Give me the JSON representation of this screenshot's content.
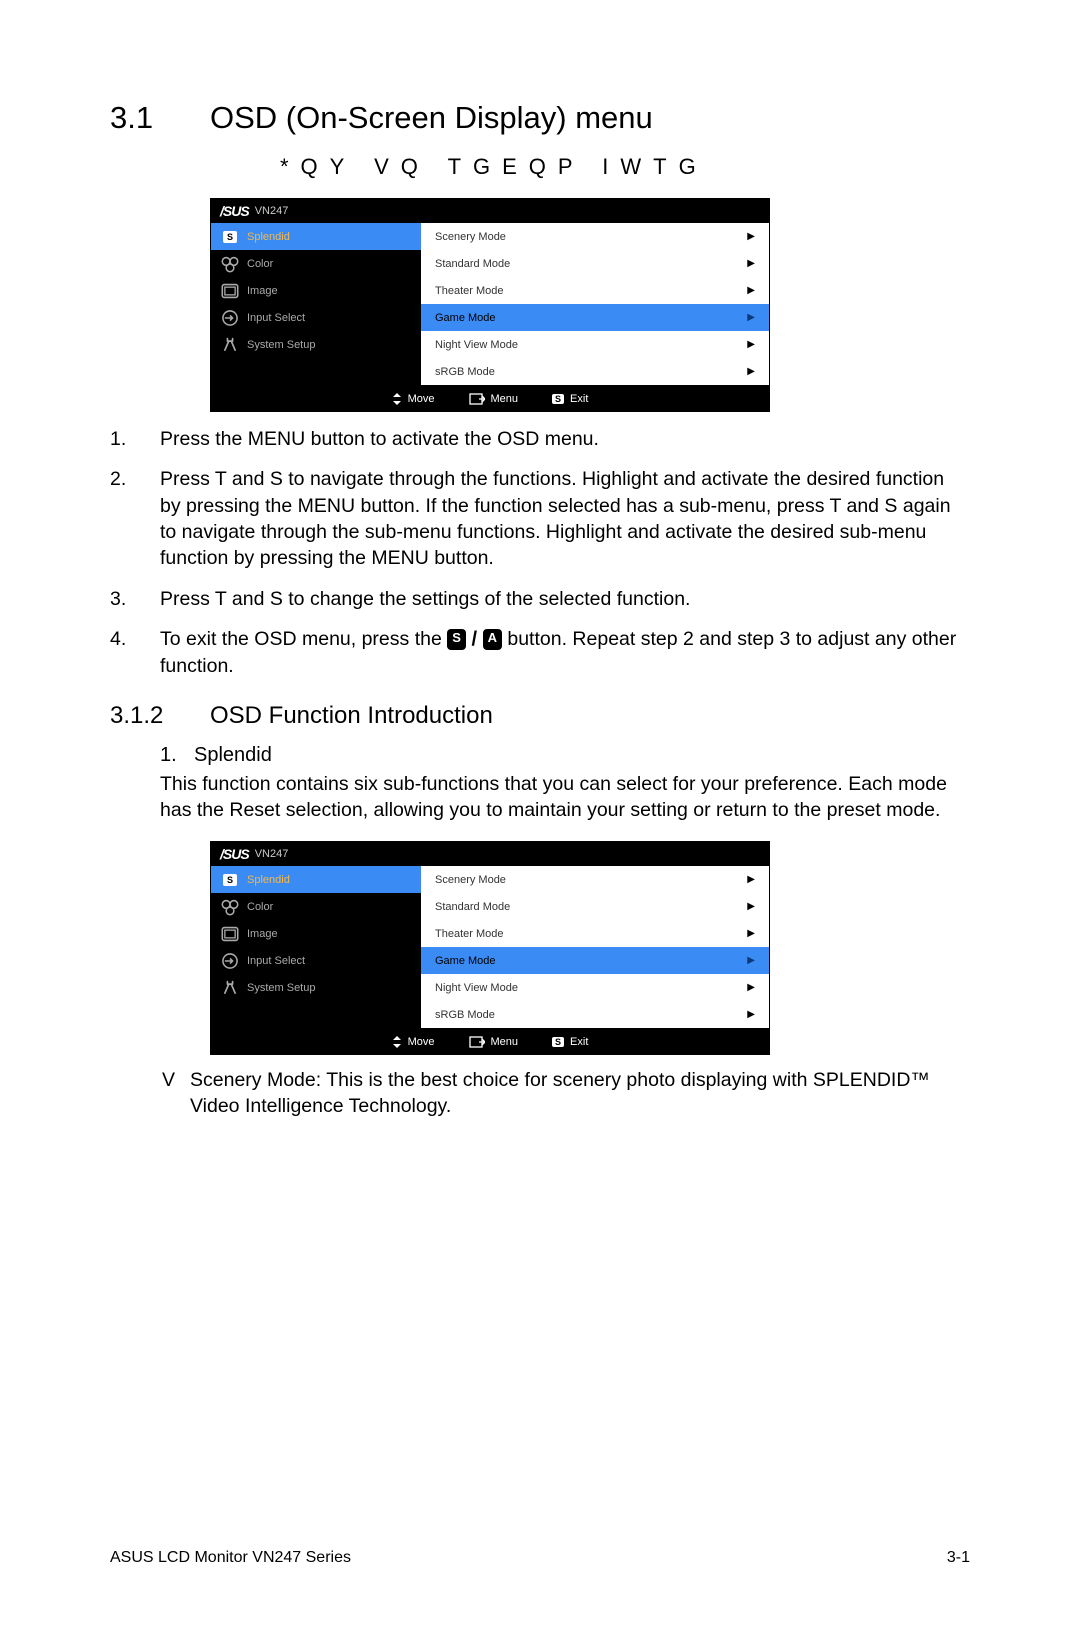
{
  "heading": {
    "num": "3.1",
    "title": "OSD (On-Screen Display) menu"
  },
  "subheading": "*QY VQ TGEQP IWTG",
  "osd": {
    "logo": "/SUS",
    "model": "VN247",
    "left_items": [
      {
        "icon": "s",
        "label": "Splendid",
        "selected": true
      },
      {
        "icon": "color",
        "label": "Color",
        "selected": false
      },
      {
        "icon": "image",
        "label": "Image",
        "selected": false
      },
      {
        "icon": "input",
        "label": "Input Select",
        "selected": false
      },
      {
        "icon": "system",
        "label": "System Setup",
        "selected": false
      }
    ],
    "right_items": [
      {
        "label": "Scenery Mode",
        "selected": false
      },
      {
        "label": "Standard Mode",
        "selected": false
      },
      {
        "label": "Theater Mode",
        "selected": false
      },
      {
        "label": "Game Mode",
        "selected": true
      },
      {
        "label": "Night View Mode",
        "selected": false
      },
      {
        "label": "sRGB Mode",
        "selected": false
      }
    ],
    "footer": {
      "move": "Move",
      "menu": "Menu",
      "exit": "Exit"
    }
  },
  "instructions": [
    "Press the MENU button to activate the OSD menu.",
    "Press  T and  S to navigate through the functions. Highlight and activate the desired function by pressing the MENU button. If the function selected has a sub-menu, press  T and  S again to navigate through the sub-menu functions. Highlight and activate the desired sub-menu function by pressing the MENU button.",
    "Press  T and  S to change the settings of the selected function.",
    {
      "pre": "To exit the OSD menu, press the ",
      "badge1": "S",
      "sep": " / ",
      "badge2": "A",
      "post": " button. Repeat step 2 and step 3 to adjust any other function."
    }
  ],
  "sub_section": {
    "num": "3.1.2",
    "title": "OSD Function Introduction"
  },
  "splendid": {
    "num": "1.",
    "title": "Splendid",
    "desc": "This function contains six sub-functions that you can select for your preference. Each mode has the Reset selection, allowing you to maintain your setting or return to the preset mode."
  },
  "bullet": {
    "marker": "V",
    "text": "Scenery Mode: This is the best choice for scenery photo displaying with SPLENDID™ Video Intelligence Technology."
  },
  "footer": {
    "left": "ASUS LCD Monitor VN247 Series",
    "right": "3-1"
  }
}
